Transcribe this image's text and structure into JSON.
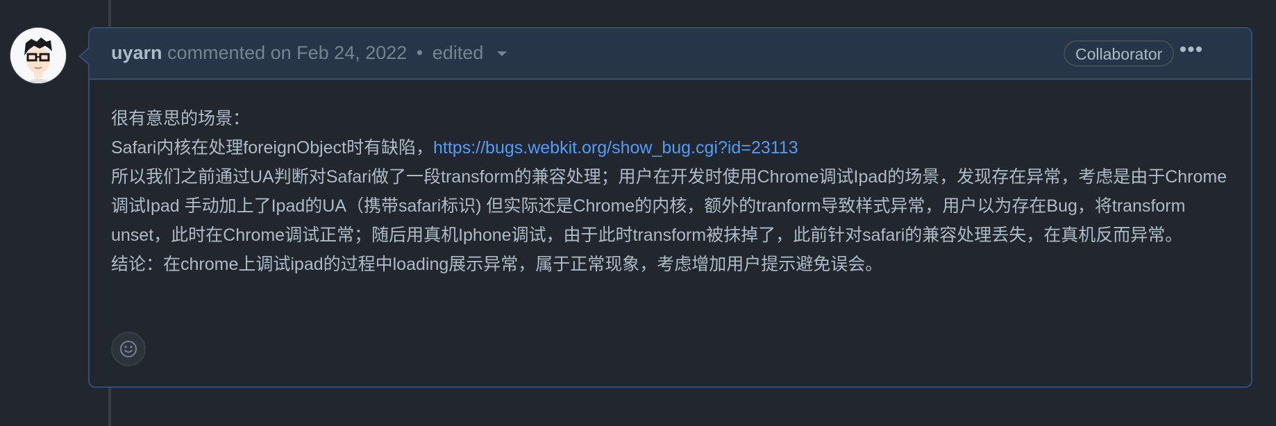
{
  "comment": {
    "author": "uyarn",
    "action": "commented on Feb 24, 2022",
    "separator": "•",
    "edited": "edited",
    "badge": "Collaborator",
    "more_icon": "kebab-horizontal-icon",
    "body": {
      "line1": "很有意思的场景：",
      "line2_prefix": "Safari内核在处理foreignObject时有缺陷，",
      "line2_link": "https://bugs.webkit.org/show_bug.cgi?id=23113",
      "paragraph": "所以我们之前通过UA判断对Safari做了一段transform的兼容处理；用户在开发时使用Chrome调试Ipad的场景，发现存在异常，考虑是由于Chrome调试Ipad 手动加上了Ipad的UA（携带safari标识) 但实际还是Chrome的内核，额外的tranform导致样式异常，用户以为存在Bug，将transform unset，此时在Chrome调试正常；随后用真机Iphone调试，由于此时transform被抹掉了，此前针对safari的兼容处理丢失，在真机反而异常。",
      "conclusion": "结论：在chrome上调试ipad的过程中loading展示异常，属于正常现象，考虑增加用户提示避免误会。"
    },
    "reaction_icon": "smiley-icon"
  },
  "colors": {
    "background": "#22272e",
    "header_bg": "#263547",
    "border": "#2f4e7a",
    "text": "#adbac7",
    "muted": "#768390",
    "link": "#539bf5"
  }
}
